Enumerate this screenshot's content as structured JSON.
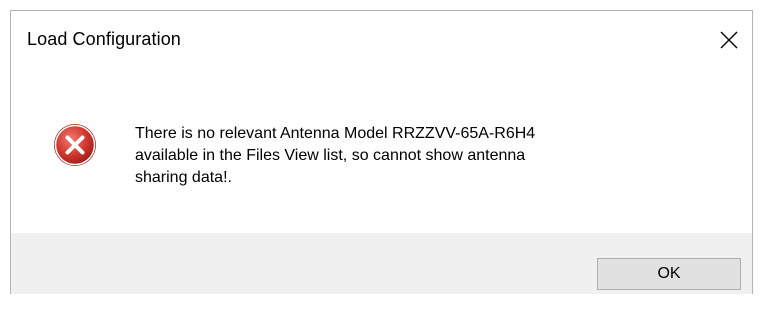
{
  "dialog": {
    "title": "Load Configuration",
    "close_icon": "close-icon",
    "message": "There is no relevant Antenna Model RRZZVV-65A-R6H4 available in the Files View list, so cannot show antenna sharing data!.",
    "message_lines": [
      "There is no relevant Antenna Model RRZZVV-65A-R6H4",
      "available in the Files View list, so cannot show antenna",
      "sharing data!."
    ],
    "icon": "error-icon",
    "ok_label": "OK"
  },
  "colors": {
    "error_red": "#d0342c",
    "footer_bg": "#f0f0f0",
    "button_bg": "#e1e1e1",
    "button_border": "#adadad"
  }
}
